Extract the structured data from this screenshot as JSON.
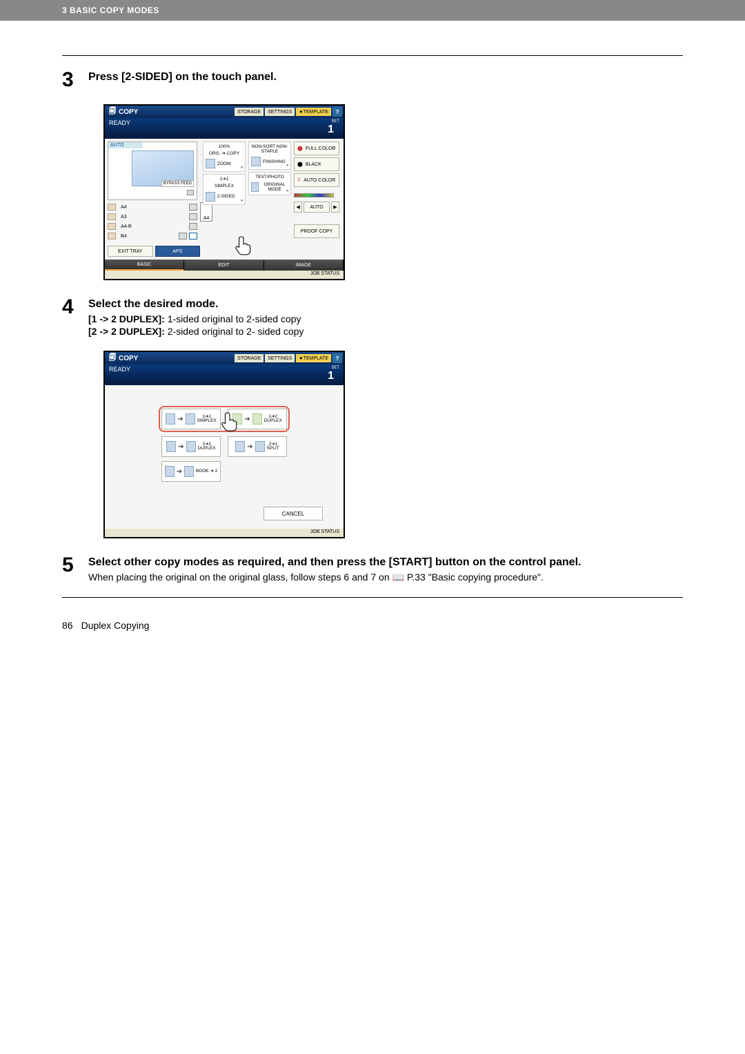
{
  "header": {
    "section": "3 BASIC COPY MODES"
  },
  "steps": {
    "s3": {
      "num": "3",
      "title": "Press [2-SIDED] on the touch panel."
    },
    "s4": {
      "num": "4",
      "title": "Select the desired mode.",
      "line1_bold": "[1 -> 2 DUPLEX]:",
      "line1_rest": " 1-sided original to 2-sided copy",
      "line2_bold": "[2 -> 2 DUPLEX]:",
      "line2_rest": " 2-sided original to 2- sided copy"
    },
    "s5": {
      "num": "5",
      "title": "Select other copy modes as required, and then press the [START] button on the control panel.",
      "body_pre": "When placing the original on the original glass, follow steps 6 and 7 on ",
      "body_ref": "P.33 \"Basic copying procedure\"",
      "body_post": "."
    }
  },
  "screenshot1": {
    "title": "COPY",
    "top_buttons": {
      "storage": "STORAGE",
      "settings": "SETTINGS",
      "template": "TEMPLATE",
      "help": "?"
    },
    "status": {
      "ready": "READY",
      "set_label": "SET",
      "count": "1"
    },
    "auto_label": "AUTO",
    "bypass": "BYPASS FEED",
    "sizes": [
      "A4",
      "A3",
      "A4-R",
      "B4"
    ],
    "a4_chip": "A4",
    "exit_tray": "EXIT TRAY",
    "aps": "APS",
    "zoom_group": {
      "ratio": "100%",
      "flow": "ORG. ➔ COPY",
      "zoom": "ZOOM"
    },
    "finish_group": {
      "nonsort": "NON-SORT NON-STAPLE",
      "finishing": "FINISHING"
    },
    "duplex_group": {
      "simplex_t": "1➔1",
      "simplex": "SIMPLEX",
      "twosided": "2-SIDED"
    },
    "mode_group": {
      "textphoto": "TEXT/PHOTO",
      "original": "ORIGINAL MODE"
    },
    "color_group": {
      "full": "FULL COLOR",
      "black": "BLACK",
      "auto": "AUTO COLOR"
    },
    "auto_btn": "AUTO",
    "proof": "PROOF COPY",
    "tabs": {
      "basic": "BASIC",
      "edit": "EDIT",
      "image": "IMAGE"
    },
    "job_status": "JOB STATUS"
  },
  "screenshot2": {
    "title": "COPY",
    "top_buttons": {
      "storage": "STORAGE",
      "settings": "SETTINGS",
      "template": "TEMPLATE",
      "help": "?"
    },
    "status": {
      "ready": "READY",
      "set_label": "SET",
      "count": "1"
    },
    "options": {
      "simplex": {
        "top": "1➔1",
        "bottom": "SIMPLEX"
      },
      "duplex12": {
        "top": "1➔2",
        "bottom": "DUPLEX"
      },
      "duplex22": {
        "top": "2➔2",
        "bottom": "DUPLEX"
      },
      "split21": {
        "top": "2➔1",
        "bottom": "SPLIT"
      },
      "book2": {
        "top": "BOOK ➔ 2",
        "bottom": ""
      }
    },
    "cancel": "CANCEL",
    "job_status": "JOB STATUS"
  },
  "footer": {
    "page": "86",
    "label": "Duplex Copying"
  },
  "icons": {
    "book": "📖",
    "star": "★",
    "play_l": "◀",
    "play_r": "▶"
  }
}
